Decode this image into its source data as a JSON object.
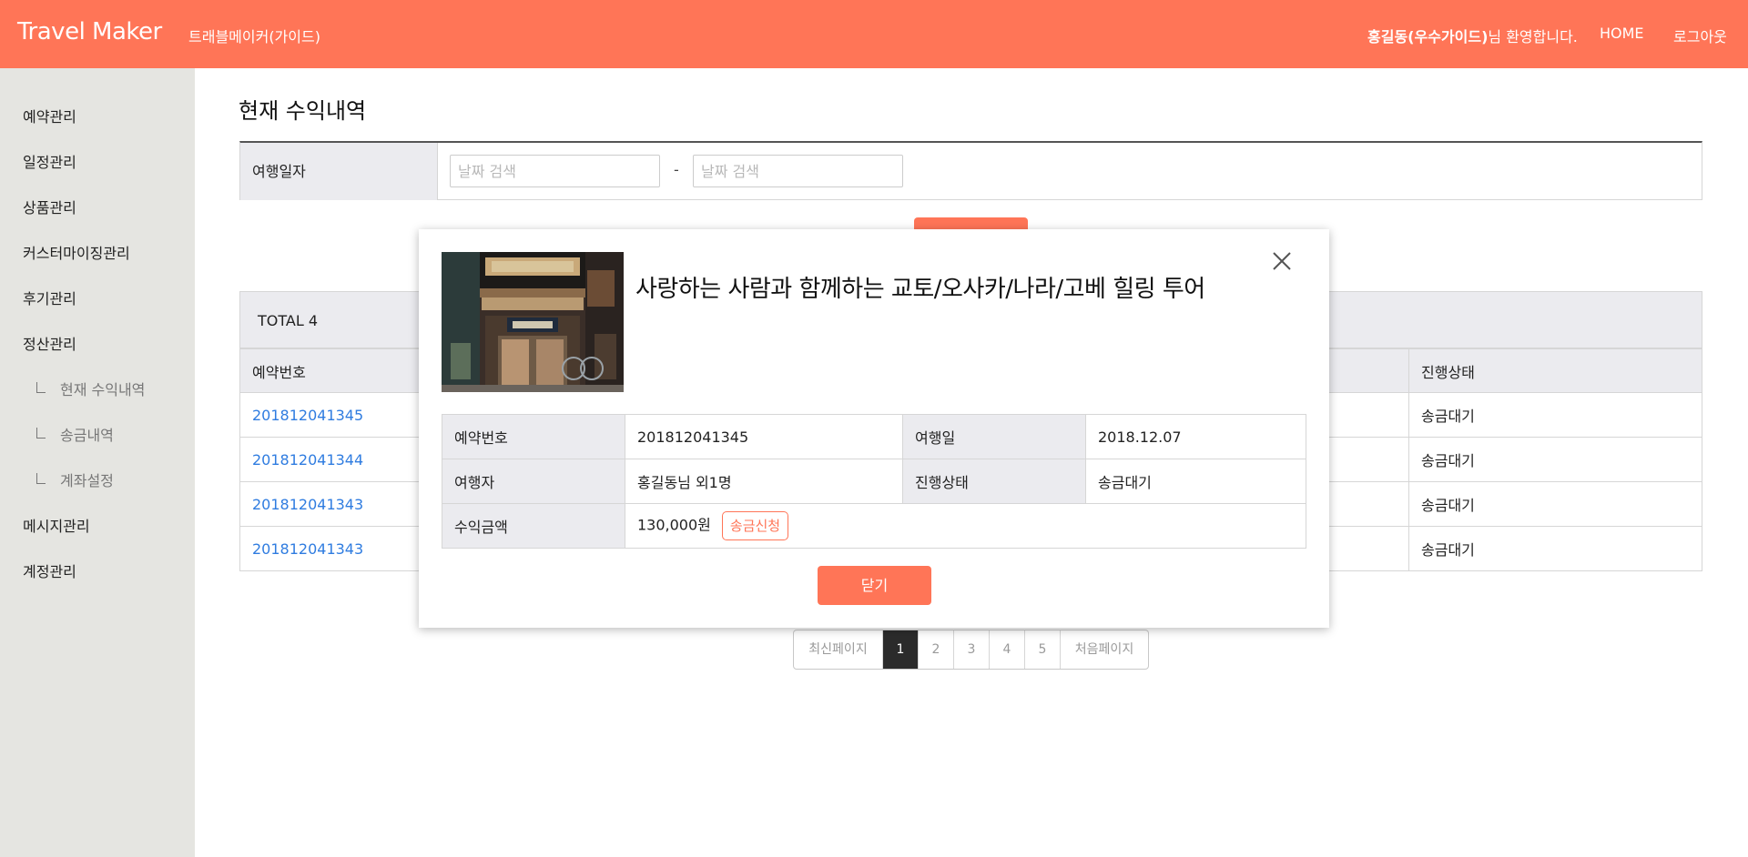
{
  "header": {
    "brand": "Travel Maker",
    "subtitle": "트래블메이커(가이드)",
    "welcome_name": "홍길동(우수가이드)",
    "welcome_suffix": "님 환영합니다.",
    "home_label": "HOME",
    "logout_label": "로그아웃",
    "accent_color": "#ff7557"
  },
  "sidebar": {
    "items": [
      {
        "label": "예약관리"
      },
      {
        "label": "일정관리"
      },
      {
        "label": "상품관리"
      },
      {
        "label": "커스터마이징관리"
      },
      {
        "label": "후기관리"
      },
      {
        "label": "정산관리"
      }
    ],
    "subitems": [
      {
        "label": "현재 수익내역"
      },
      {
        "label": "송금내역"
      },
      {
        "label": "계좌설정"
      }
    ],
    "items_after": [
      {
        "label": "메시지관리"
      },
      {
        "label": "계정관리"
      }
    ]
  },
  "main": {
    "title": "현재 수익내역",
    "search": {
      "label": "여행일자",
      "start_placeholder": "날짜 검색",
      "end_placeholder": "날짜 검색",
      "separator": "-"
    },
    "total_label": "TOTAL 4",
    "columns": {
      "first": "예약번호",
      "last": "진행상태"
    },
    "rows": [
      {
        "id": "201812041345",
        "status": "송금대기"
      },
      {
        "id": "201812041344",
        "status": "송금대기"
      },
      {
        "id": "201812041343",
        "status": "송금대기"
      },
      {
        "id": "201812041343",
        "status": "송금대기"
      }
    ],
    "pagination": {
      "first_label": "최신페이지",
      "pages": [
        "1",
        "2",
        "3",
        "4",
        "5"
      ],
      "current": "1",
      "last_label": "처음페이지"
    }
  },
  "modal": {
    "title": "사랑하는 사람과 함께하는 교토/오사카/나라/고베 힐링 투어",
    "image_subject": "japanese-shop-storefront",
    "fields": {
      "reservation_no_label": "예약번호",
      "reservation_no": "201812041345",
      "travel_date_label": "여행일",
      "travel_date": "2018.12.07",
      "traveler_label": "여행자",
      "traveler": "홍길동님 외1명",
      "status_label": "진행상태",
      "status": "송금대기",
      "amount_label": "수익금액",
      "amount": "130,000원"
    },
    "send_button": "송금신청",
    "close_button": "닫기"
  }
}
